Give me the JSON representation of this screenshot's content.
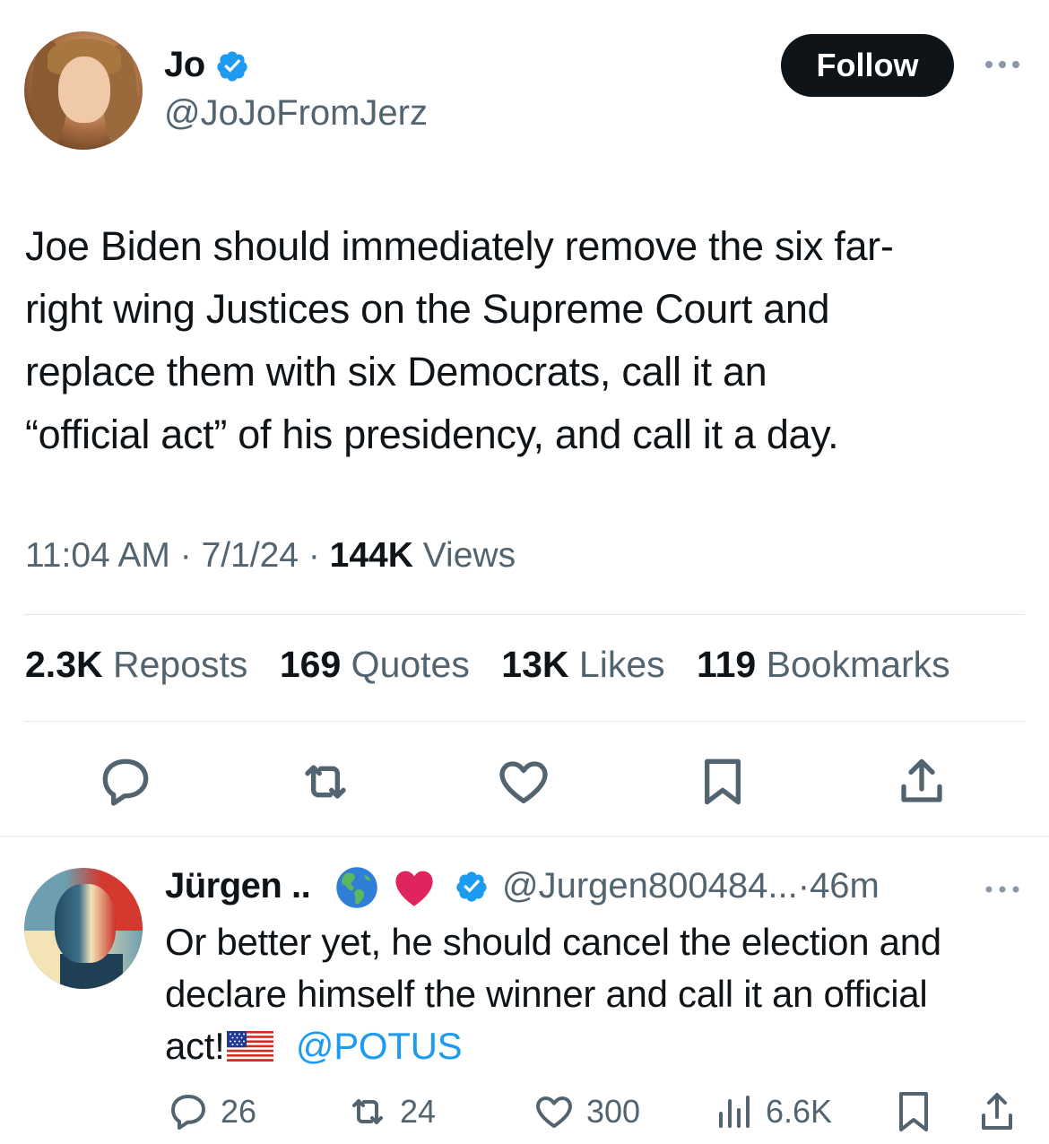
{
  "main_tweet": {
    "author": {
      "name": "Jo",
      "handle": "@JoJoFromJerz",
      "verified": true
    },
    "follow_label": "Follow",
    "text_lines": [
      "Joe Biden should immediately remove the six far-",
      "right wing Justices on the Supreme Court and",
      "replace them with six Democrats, call it an",
      "“official act” of his presidency, and call it a day."
    ],
    "meta": {
      "time": "11:04 AM",
      "date": "7/1/24",
      "views_count": "144K",
      "views_label": "Views"
    },
    "stats": {
      "reposts_count": "2.3K",
      "reposts_label": "Reposts",
      "quotes_count": "169",
      "quotes_label": "Quotes",
      "likes_count": "13K",
      "likes_label": "Likes",
      "bookmarks_count": "119",
      "bookmarks_label": "Bookmarks"
    },
    "action_icons": [
      "reply-icon",
      "repost-icon",
      "like-icon",
      "bookmark-icon",
      "share-icon"
    ]
  },
  "reply": {
    "author": {
      "name": "Jürgen ..",
      "emojis": [
        "globe-americas-emoji",
        "red-heart-emoji"
      ],
      "verified": true,
      "handle": "@Jurgen800484...",
      "separator": "·",
      "age": "46m"
    },
    "text_line1": "Or better yet, he should cancel the election and",
    "text_line2": "declare himself the winner and call it an official",
    "text_line3_prefix": "act!",
    "text_line3_mention": "@POTUS",
    "actions": {
      "replies": "26",
      "reposts": "24",
      "likes": "300",
      "views": "6.6K"
    }
  },
  "colors": {
    "text_primary": "#0f1419",
    "text_secondary": "#536471",
    "accent": "#1d9bf0",
    "follow_bg": "#0f1419",
    "divider": "#e1e6ea"
  }
}
